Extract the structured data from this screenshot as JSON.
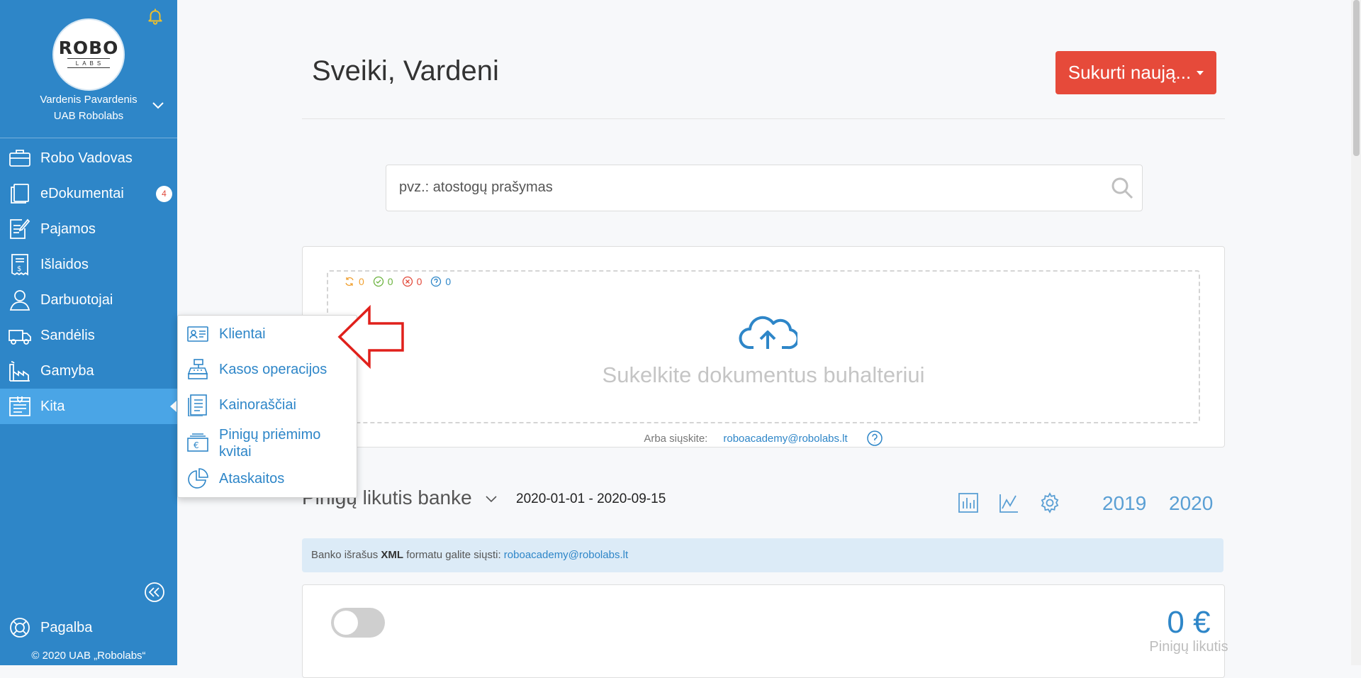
{
  "sidebar": {
    "logo": {
      "top": "ROBO",
      "bottom": "LABS"
    },
    "user_name": "Vardenis Pavardenis",
    "company": "UAB Robolabs",
    "items": [
      {
        "label": "Robo Vadovas",
        "icon": "briefcase-icon"
      },
      {
        "label": "eDokumentai",
        "icon": "documents-icon",
        "badge": "4"
      },
      {
        "label": "Pajamos",
        "icon": "invoice-edit-icon"
      },
      {
        "label": "Išlaidos",
        "icon": "receipt-icon"
      },
      {
        "label": "Darbuotojai",
        "icon": "person-icon"
      },
      {
        "label": "Sandėlis",
        "icon": "truck-icon"
      },
      {
        "label": "Gamyba",
        "icon": "factory-icon"
      },
      {
        "label": "Kita",
        "icon": "tray-icon",
        "active": true
      }
    ],
    "help": "Pagalba",
    "copyright": "© 2020 UAB „Robolabs“"
  },
  "header": {
    "greeting": "Sveiki, Vardeni",
    "create_button": "Sukurti naują..."
  },
  "search": {
    "placeholder": "pvz.: atostogų prašymas"
  },
  "upload": {
    "stats": [
      {
        "icon": "sync-icon",
        "value": "0",
        "color": "#f0a030"
      },
      {
        "icon": "check-circle-icon",
        "value": "0",
        "color": "#6cb33f"
      },
      {
        "icon": "x-circle-icon",
        "value": "0",
        "color": "#e24a3b"
      },
      {
        "icon": "question-circle-icon",
        "value": "0",
        "color": "#2e86c8"
      }
    ],
    "prompt": "Sukelkite dokumentus buhalteriui",
    "email_prefix": "Arba siųskite:",
    "email": "roboacademy@robolabs.lt"
  },
  "popup_menu": {
    "items": [
      {
        "label": "Klientai",
        "icon": "contact-card-icon"
      },
      {
        "label": "Kasos operacijos",
        "icon": "cash-register-icon"
      },
      {
        "label": "Kainoraščiai",
        "icon": "price-list-icon"
      },
      {
        "label": "Pinigų priėmimo kvitai",
        "icon": "euro-receipt-icon"
      },
      {
        "label": "Ataskaitos",
        "icon": "pie-chart-icon"
      }
    ]
  },
  "balance": {
    "title": "Pinigų likutis banke",
    "date_range": "2020-01-01 - 2020-09-15",
    "years": [
      "2019",
      "2020"
    ],
    "info_prefix": "Banko išrašus",
    "info_bold": "XML",
    "info_middle": "formatu galite siųsti:",
    "info_email": "roboacademy@robolabs.lt",
    "value": "0 €",
    "label": "Pinigų likutis"
  },
  "colors": {
    "sidebar": "#2e86c8",
    "sidebar_active": "#4aa5e6",
    "accent_red": "#e64a3a",
    "link": "#2e86c8"
  }
}
